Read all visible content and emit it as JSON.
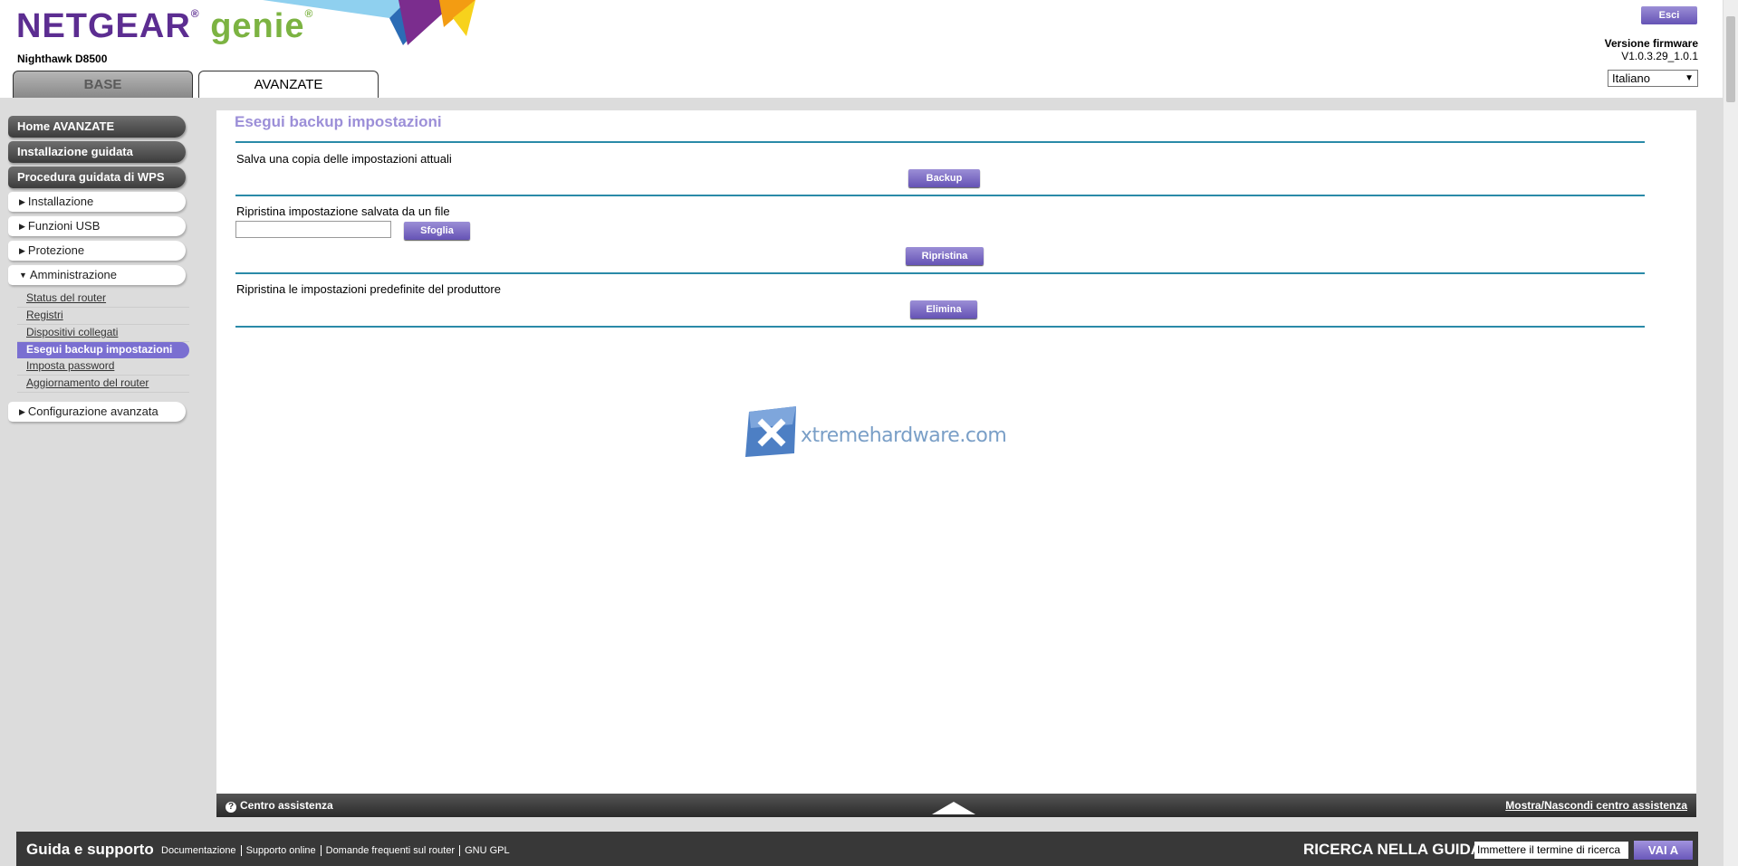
{
  "header": {
    "brand": "NETGEAR",
    "brand_reg": "®",
    "product": "genie",
    "product_reg": "®",
    "model": "Nighthawk D8500",
    "logout_label": "Esci",
    "firmware_label": "Versione firmware",
    "firmware_version": "V1.0.3.29_1.0.1",
    "language": "Italiano"
  },
  "tabs": [
    {
      "label": "BASE",
      "active": false
    },
    {
      "label": "AVANZATE",
      "active": true
    }
  ],
  "sidebar": {
    "primary": [
      {
        "label": "Home AVANZATE"
      },
      {
        "label": "Installazione guidata"
      },
      {
        "label": "Procedura guidata di WPS"
      }
    ],
    "sections": [
      {
        "label": "Installazione",
        "expanded": false
      },
      {
        "label": "Funzioni USB",
        "expanded": false
      },
      {
        "label": "Protezione",
        "expanded": false
      },
      {
        "label": "Amministrazione",
        "expanded": true
      }
    ],
    "admin_items": [
      {
        "label": "Status del router"
      },
      {
        "label": "Registri"
      },
      {
        "label": "Dispositivi collegati"
      },
      {
        "label": "Esegui backup impostazioni",
        "active": true
      },
      {
        "label": "Imposta password"
      },
      {
        "label": "Aggiornamento del router"
      }
    ],
    "advanced": {
      "label": "Configurazione avanzata",
      "expanded": false
    }
  },
  "main": {
    "title": "Esegui backup impostazioni",
    "backup_label": "Salva una copia delle impostazioni attuali",
    "backup_button": "Backup",
    "restore_label": "Ripristina impostazione salvata da un file",
    "browse_button": "Sfoglia",
    "restore_button": "Ripristina",
    "factory_label": "Ripristina le impostazioni predefinite del produttore",
    "erase_button": "Elimina",
    "watermark": "xtremehardware.com"
  },
  "helpbar": {
    "left": "Centro assistenza",
    "right": "Mostra/Nascondi centro assistenza"
  },
  "footer": {
    "title": "Guida e supporto",
    "links": [
      "Documentazione",
      "Supporto online",
      "Domande frequenti sul router",
      "GNU GPL"
    ],
    "search_title": "RICERCA NELLA GUIDA",
    "search_value": "Immettere il termine di ricerca",
    "search_button": "VAI A"
  },
  "colors": {
    "accent": "#7a6fd1",
    "brand": "#5c2d91",
    "genie": "#7cb342",
    "divider": "#2a8aa8"
  }
}
